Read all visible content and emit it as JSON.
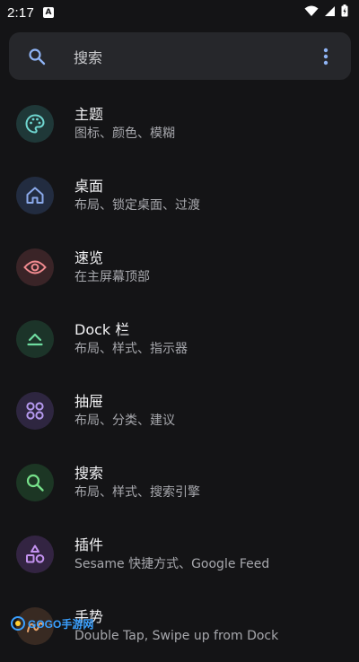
{
  "status": {
    "time": "2:17",
    "a_badge": "A"
  },
  "search": {
    "placeholder": "搜索"
  },
  "items": [
    {
      "title": "主题",
      "subtitle": "图标、颜色、模糊",
      "icon": "palette-icon"
    },
    {
      "title": "桌面",
      "subtitle": "布局、锁定桌面、过渡",
      "icon": "home-icon"
    },
    {
      "title": "速览",
      "subtitle": "在主屏幕顶部",
      "icon": "eye-icon"
    },
    {
      "title": "Dock 栏",
      "subtitle": "布局、样式、指示器",
      "icon": "dock-icon"
    },
    {
      "title": "抽屉",
      "subtitle": "布局、分类、建议",
      "icon": "drawer-grid-icon"
    },
    {
      "title": "搜索",
      "subtitle": "布局、样式、搜索引擎",
      "icon": "search-icon"
    },
    {
      "title": "插件",
      "subtitle": "Sesame 快捷方式、Google Feed",
      "icon": "plugins-icon"
    },
    {
      "title": "手势",
      "subtitle": "Double Tap, Swipe up from Dock",
      "icon": "gesture-icon"
    }
  ],
  "watermark": {
    "text": "GOGO手游网"
  }
}
